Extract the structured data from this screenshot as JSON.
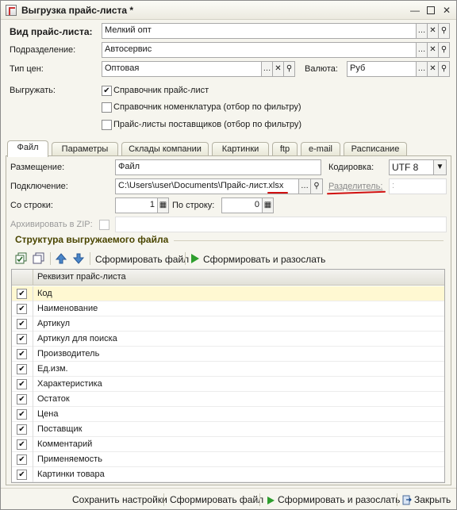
{
  "window": {
    "title": "Выгрузка прайс-листа *"
  },
  "form": {
    "pricelist_type_label": "Вид прайс-листа:",
    "pricelist_type_value": "Мелкий опт",
    "division_label": "Подразделение:",
    "division_value": "Автосервис",
    "price_type_label": "Тип цен:",
    "price_type_value": "Оптовая",
    "currency_label": "Валюта:",
    "currency_value": "Руб",
    "export_label": "Выгружать:",
    "export_options": [
      {
        "label": "Справочник прайс-лист",
        "checked": true
      },
      {
        "label": "Справочник номенклатура (отбор по фильтру)",
        "checked": false
      },
      {
        "label": "Прайс-листы поставщиков (отбор по фильтру)",
        "checked": false
      }
    ]
  },
  "tabs": [
    "Файл",
    "Параметры",
    "Склады компании",
    "Картинки",
    "ftp",
    "e-mail",
    "Расписание"
  ],
  "file_tab": {
    "placement_label": "Размещение:",
    "placement_value": "Файл",
    "encoding_label": "Кодировка:",
    "encoding_value": "UTF 8",
    "connection_label": "Подключение:",
    "connection_value": "C:\\Users\\user\\Documents\\Прайс-лист.xlsx",
    "separator_label": "Разделитель:",
    "separator_value": ":",
    "from_row_label": "Со строки:",
    "from_row_value": "1",
    "to_row_label": "По строку:",
    "to_row_value": "0",
    "archive_label": "Архивировать в ZIP:"
  },
  "structure": {
    "title": "Структура выгружаемого файла",
    "toolbar": {
      "generate_file": "Сформировать файл",
      "generate_and_send": "Сформировать и разослать"
    },
    "column_header": "Реквизит прайс-листа",
    "rows": [
      {
        "name": "Код",
        "checked": true
      },
      {
        "name": "Наименование",
        "checked": true
      },
      {
        "name": "Артикул",
        "checked": true
      },
      {
        "name": "Артикул для поиска",
        "checked": true
      },
      {
        "name": "Производитель",
        "checked": true
      },
      {
        "name": "Ед.изм.",
        "checked": true
      },
      {
        "name": "Характеристика",
        "checked": true
      },
      {
        "name": "Остаток",
        "checked": true
      },
      {
        "name": "Цена",
        "checked": true
      },
      {
        "name": "Поставщик",
        "checked": true
      },
      {
        "name": "Комментарий",
        "checked": true
      },
      {
        "name": "Применяемость",
        "checked": true
      },
      {
        "name": "Картинки товара",
        "checked": true
      }
    ]
  },
  "footer": {
    "save_settings": "Сохранить настройки",
    "generate_file": "Сформировать файл",
    "generate_and_send": "Сформировать и разослать",
    "close": "Закрыть"
  },
  "colors": {
    "accent_red": "#d01010",
    "play_green": "#2e9e2e",
    "title_olive": "#4a4500"
  }
}
